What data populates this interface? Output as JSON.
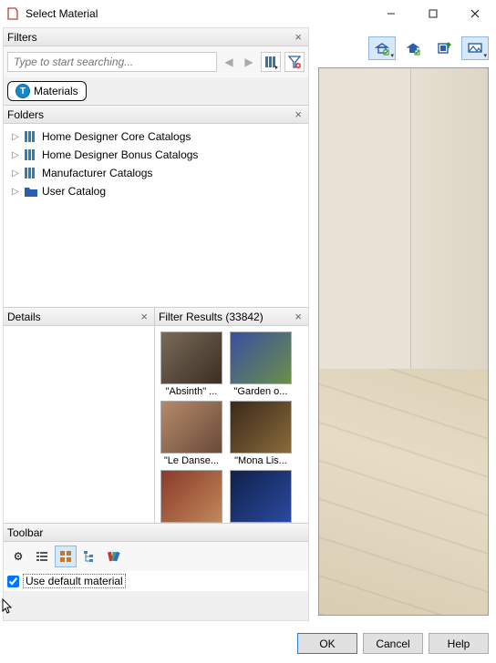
{
  "window": {
    "title": "Select Material"
  },
  "filters": {
    "title": "Filters",
    "placeholder": "Type to start searching...",
    "materials_tab": "Materials"
  },
  "folders": {
    "title": "Folders",
    "items": [
      {
        "label": "Home Designer Core Catalogs",
        "icon": "books"
      },
      {
        "label": "Home Designer Bonus Catalogs",
        "icon": "books"
      },
      {
        "label": "Manufacturer Catalogs",
        "icon": "books"
      },
      {
        "label": "User Catalog",
        "icon": "folder"
      }
    ]
  },
  "details": {
    "title": "Details"
  },
  "results": {
    "title": "Filter Results (33842)",
    "thumbs": [
      {
        "label": "\"Absinth\" ..."
      },
      {
        "label": "\"Garden o..."
      },
      {
        "label": "\"Le Danse..."
      },
      {
        "label": "\"Mona Lis..."
      },
      {
        "label": ""
      },
      {
        "label": ""
      }
    ]
  },
  "toolbar": {
    "title": "Toolbar"
  },
  "default_material": {
    "label": "Use default material",
    "checked": true
  },
  "buttons": {
    "ok": "OK",
    "cancel": "Cancel",
    "help": "Help"
  }
}
